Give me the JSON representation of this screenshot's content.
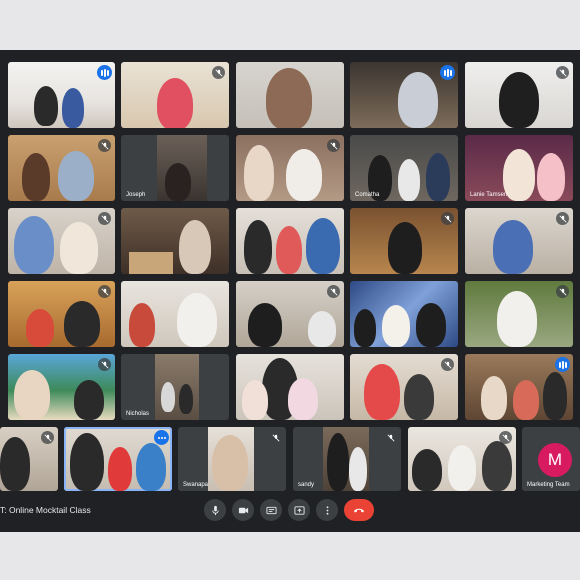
{
  "meeting": {
    "title": "T: Online Mocktail Class"
  },
  "tiles": [
    {
      "name": "",
      "speaking": true
    },
    {
      "name": "",
      "speaking": false
    },
    {
      "name": "",
      "speaking": false
    },
    {
      "name": "",
      "speaking": true
    },
    {
      "name": "",
      "speaking": false
    },
    {
      "name": "",
      "speaking": false
    },
    {
      "name": "Joseph",
      "speaking": false
    },
    {
      "name": "",
      "speaking": false
    },
    {
      "name": "Comatha",
      "speaking": false
    },
    {
      "name": "Lanie Tamsen",
      "speaking": false
    },
    {
      "name": "",
      "speaking": false
    },
    {
      "name": "",
      "speaking": false
    },
    {
      "name": "",
      "speaking": false
    },
    {
      "name": "",
      "speaking": false
    },
    {
      "name": "",
      "speaking": false
    },
    {
      "name": "",
      "speaking": false
    },
    {
      "name": "",
      "speaking": false
    },
    {
      "name": "",
      "speaking": false
    },
    {
      "name": "",
      "speaking": false
    },
    {
      "name": "",
      "speaking": false
    },
    {
      "name": "",
      "speaking": false
    },
    {
      "name": "Nicholas",
      "speaking": false
    },
    {
      "name": "",
      "speaking": false
    },
    {
      "name": "",
      "speaking": false
    },
    {
      "name": "",
      "speaking": true
    },
    {
      "name": "",
      "speaking": false
    },
    {
      "name": "",
      "speaking": false
    },
    {
      "name": "Swanapa",
      "speaking": false
    },
    {
      "name": "sandy",
      "speaking": false
    },
    {
      "name": "",
      "speaking": false
    },
    {
      "name": "Marketing Team",
      "speaking": false
    }
  ],
  "avatar_letter": "M",
  "colors": {
    "background": "#202124",
    "hangup": "#ea4335",
    "speaking": "#1a73e8",
    "avatar": "#d81b60"
  },
  "icons": [
    "mic-icon",
    "camera-icon",
    "captions-icon",
    "present-icon",
    "more-icon",
    "hangup-icon"
  ]
}
